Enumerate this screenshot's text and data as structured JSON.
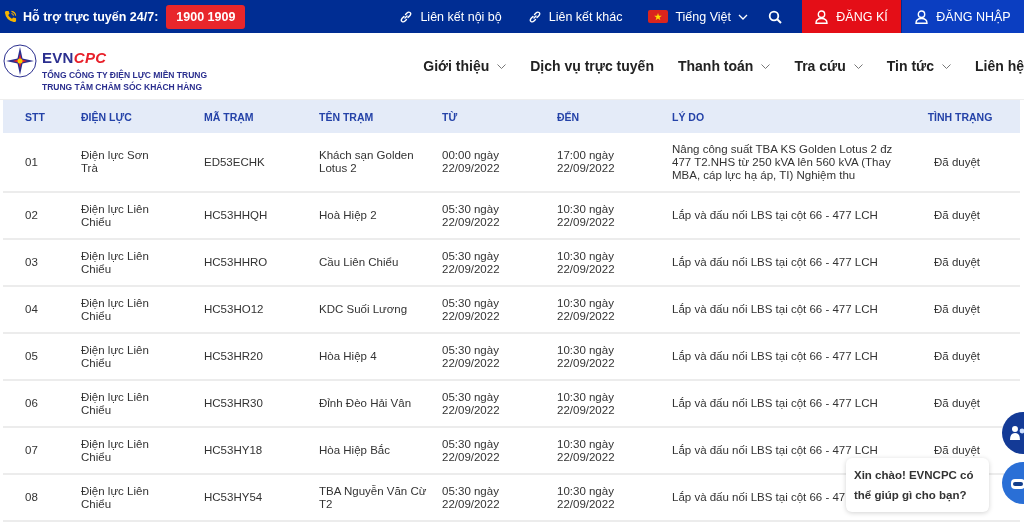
{
  "top_bar": {
    "support_label": "Hỗ trợ trực tuyến 24/7:",
    "hotline": "1900 1909",
    "links": [
      {
        "label": "Liên kết nội bộ"
      },
      {
        "label": "Liên kết khác"
      }
    ],
    "language": "Tiếng Việt",
    "buttons": [
      {
        "kind": "register",
        "label": "ĐĂNG KÍ"
      },
      {
        "kind": "login",
        "label": "ĐĂNG NHẬP"
      }
    ]
  },
  "header": {
    "brand": [
      "EVN",
      "CPC"
    ],
    "subtitle_lines": [
      "TỔNG CÔNG TY ĐIỆN LỰC MIỀN TRUNG",
      "TRUNG TÂM CHĂM SÓC KHÁCH HÀNG"
    ],
    "nav": [
      {
        "label": "Giới thiệu",
        "dropdown": true
      },
      {
        "label": "Dịch vụ trực tuyến",
        "dropdown": false
      },
      {
        "label": "Thanh toán",
        "dropdown": true
      },
      {
        "label": "Tra cứu",
        "dropdown": true
      },
      {
        "label": "Tin tức",
        "dropdown": true
      },
      {
        "label": "Liên hệ",
        "dropdown": false
      }
    ]
  },
  "table": {
    "columns": [
      "STT",
      "ĐIỆN LỰC",
      "MÃ TRẠM",
      "TÊN TRẠM",
      "TỪ",
      "ĐẾN",
      "LÝ DO",
      "TÌNH TRẠNG"
    ],
    "rows": [
      [
        "01",
        "Điện lực Sơn Trà",
        "ED53ECHK",
        "Khách sạn Golden Lotus 2",
        "00:00 ngày 22/09/2022",
        "17:00 ngày 22/09/2022",
        "Nâng công suất TBA KS Golden Lotus 2 đz 477 T2.NHS từ 250 kVA lên 560 kVA (Thay MBA, cáp lực hạ áp, TI) Nghiệm thu",
        "Đã duyệt"
      ],
      [
        "02",
        "Điện lực Liên Chiểu",
        "HC53HHQH",
        "Hoà Hiệp 2",
        "05:30 ngày 22/09/2022",
        "10:30 ngày 22/09/2022",
        "Lắp và đấu nối LBS tại cột 66 - 477 LCH",
        "Đã duyệt"
      ],
      [
        "03",
        "Điện lực Liên Chiểu",
        "HC53HHRO",
        "Cầu Liên Chiểu",
        "05:30 ngày 22/09/2022",
        "10:30 ngày 22/09/2022",
        "Lắp và đấu nối LBS tại cột 66 - 477 LCH",
        "Đã duyệt"
      ],
      [
        "04",
        "Điện lực Liên Chiểu",
        "HC53HO12",
        "KDC Suối Lương",
        "05:30 ngày 22/09/2022",
        "10:30 ngày 22/09/2022",
        "Lắp và đấu nối LBS tại cột 66 - 477 LCH",
        "Đã duyệt"
      ],
      [
        "05",
        "Điện lực Liên Chiểu",
        "HC53HR20",
        "Hòa Hiệp 4",
        "05:30 ngày 22/09/2022",
        "10:30 ngày 22/09/2022",
        "Lắp và đấu nối LBS tại cột 66 - 477 LCH",
        "Đã duyệt"
      ],
      [
        "06",
        "Điện lực Liên Chiểu",
        "HC53HR30",
        "Đỉnh Đèo Hải Vân",
        "05:30 ngày 22/09/2022",
        "10:30 ngày 22/09/2022",
        "Lắp và đấu nối LBS tại cột 66 - 477 LCH",
        "Đã duyệt"
      ],
      [
        "07",
        "Điện lực Liên Chiểu",
        "HC53HY18",
        "Hòa Hiệp Bắc",
        "05:30 ngày 22/09/2022",
        "10:30 ngày 22/09/2022",
        "Lắp và đấu nối LBS tại cột 66 - 477 LCH",
        "Đã duyệt"
      ],
      [
        "08",
        "Điện lực Liên Chiểu",
        "HC53HY54",
        "TBA Nguyễn Văn Cừ T2",
        "05:30 ngày 22/09/2022",
        "10:30 ngày 22/09/2022",
        "Lắp và đấu nối LBS tại cột 66 - 47"
      ]
    ]
  },
  "chat_bubble": {
    "text": "Xin chào! EVNCPC có thể giúp gì cho bạn?"
  }
}
